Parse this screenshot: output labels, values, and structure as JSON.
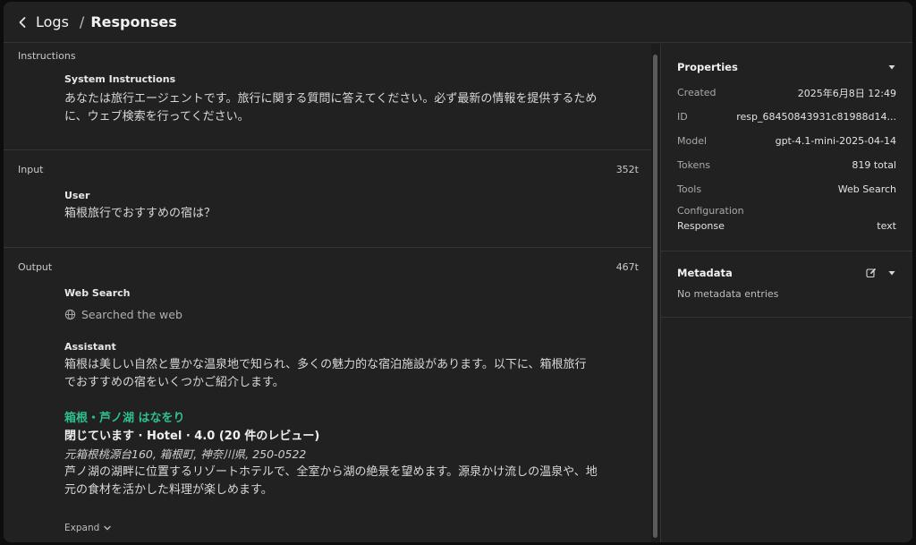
{
  "breadcrumb": {
    "parent": "Logs",
    "current": "Responses"
  },
  "instructions": {
    "header": "Instructions",
    "role": "System Instructions",
    "text": "あなたは旅行エージェントです。旅行に関する質問に答えてください。必ず最新の情報を提供するために、ウェブ検索を行ってください。"
  },
  "input": {
    "header": "Input",
    "tokens": "352t",
    "role": "User",
    "text": "箱根旅行でおすすめの宿は？"
  },
  "output": {
    "header": "Output",
    "tokens": "467t",
    "web_search_label": "Web Search",
    "web_search_status": "Searched the web",
    "assistant_label": "Assistant",
    "intro": "箱根は美しい自然と豊かな温泉地で知られ、多くの魅力的な宿泊施設があります。以下に、箱根旅行でおすすめの宿をいくつかご紹介します。",
    "hotel_name": "箱根・芦ノ湖 はなをり",
    "hotel_meta": "閉じています · Hotel · 4.0 (20 件のレビュー)",
    "hotel_address": "元箱根桃源台160, 箱根町, 神奈川県, 250-0522",
    "hotel_description": "芦ノ湖の湖畔に位置するリゾートホテルで、全室から湖の絶景を望めます。源泉かけ流しの温泉や、地元の食材を活かした料理が楽しめます。",
    "expand_label": "Expand"
  },
  "properties": {
    "title": "Properties",
    "created_label": "Created",
    "created_value": "2025年6月8日 12:49",
    "id_label": "ID",
    "id_value": "resp_68450843931c81988d14...",
    "model_label": "Model",
    "model_value": "gpt-4.1-mini-2025-04-14",
    "tokens_label": "Tokens",
    "tokens_value": "819 total",
    "tools_label": "Tools",
    "tools_value": "Web Search",
    "config_label": "Configuration",
    "response_label": "Response",
    "response_value": "text"
  },
  "metadata": {
    "title": "Metadata",
    "empty": "No metadata entries"
  }
}
